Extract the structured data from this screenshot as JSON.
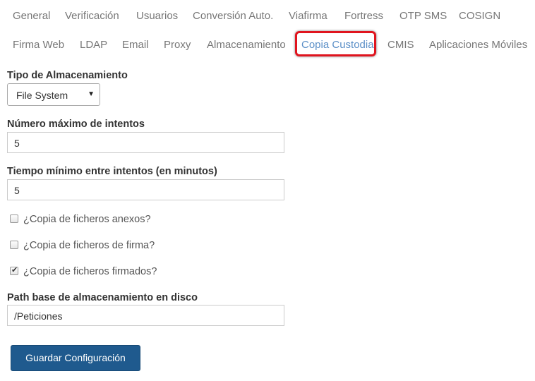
{
  "tabs": {
    "row1": [
      {
        "label": "General"
      },
      {
        "label": "Verificación"
      },
      {
        "label": "Usuarios"
      },
      {
        "label": "Conversión Auto."
      },
      {
        "label": "Viafirma"
      },
      {
        "label": "Fortress"
      },
      {
        "label": "OTP SMS"
      },
      {
        "label": "COSIGN"
      }
    ],
    "row2": [
      {
        "label": "Firma Web"
      },
      {
        "label": "LDAP"
      },
      {
        "label": "Email"
      },
      {
        "label": "Proxy"
      },
      {
        "label": "Almacenamiento"
      },
      {
        "label": "Copia Custodia",
        "active": true
      },
      {
        "label": "CMIS"
      },
      {
        "label": "Aplicaciones Móviles"
      }
    ]
  },
  "form": {
    "storage_type": {
      "label": "Tipo de Almacenamiento",
      "selected": "File System"
    },
    "max_attempts": {
      "label": "Número máximo de intentos",
      "value": "5"
    },
    "min_interval": {
      "label": "Tiempo mínimo entre intentos (en minutos)",
      "value": "5"
    },
    "checkboxes": [
      {
        "label": "¿Copia de ficheros anexos?",
        "checked": false
      },
      {
        "label": "¿Copia de ficheros de firma?",
        "checked": false
      },
      {
        "label": "¿Copia de ficheros firmados?",
        "checked": true
      }
    ],
    "base_path": {
      "label": "Path base de almacenamiento en disco",
      "value": "/Peticiones"
    },
    "save_label": "Guardar Configuración"
  },
  "colors": {
    "active_tab": "#5b8fc7",
    "highlight": "#e0141e",
    "primary_button": "#1f5a8e"
  },
  "icons": {
    "select_caret": "caret-down-icon",
    "checkmark": "check-icon"
  }
}
